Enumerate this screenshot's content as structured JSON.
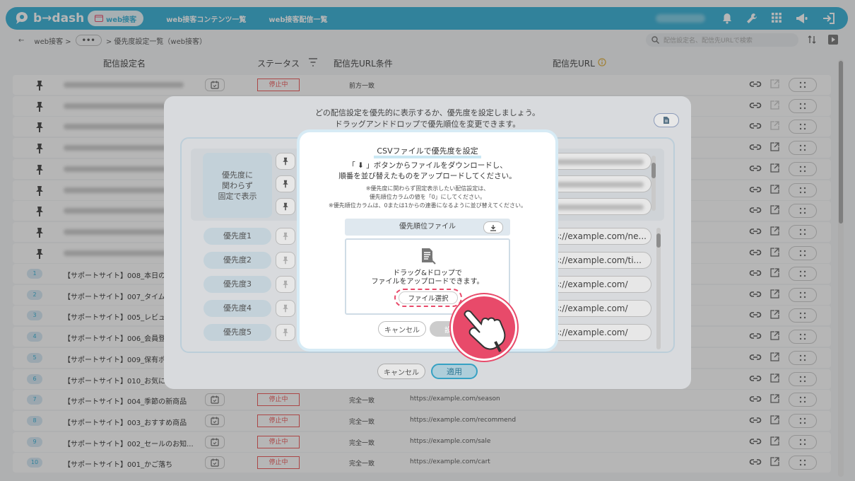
{
  "app": {
    "logo_text": "b→dash",
    "nav_active": "web接客",
    "nav_links": [
      "web接客コンテンツ一覧",
      "web接客配信一覧"
    ]
  },
  "breadcrumb": {
    "back": "←",
    "root": "web接客 >",
    "dots": "•••",
    "current": "> 優先度設定一覧（web接客）"
  },
  "search": {
    "placeholder": "配信設定名、配信先URLで検索"
  },
  "table": {
    "headers": {
      "name": "配信設定名",
      "status": "ステータス",
      "condition": "配信先URL条件",
      "url": "配信先URL"
    },
    "pinned_first": {
      "status": "停止中",
      "condition": "前方一致"
    },
    "rows": [
      {
        "num": "1",
        "name": "【サポートサイト】008_本日の新"
      },
      {
        "num": "2",
        "name": "【サポートサイト】007_タイムセ"
      },
      {
        "num": "3",
        "name": "【サポートサイト】005_レビュー"
      },
      {
        "num": "4",
        "name": "【サポートサイト】006_会員登録"
      },
      {
        "num": "5",
        "name": "【サポートサイト】009_保有ポー"
      },
      {
        "num": "6",
        "name": "【サポートサイト】010_お気に入"
      },
      {
        "num": "7",
        "name": "【サポートサイト】004_季節の新商品",
        "status": "停止中",
        "condition": "完全一致",
        "url": "https://example.com/season"
      },
      {
        "num": "8",
        "name": "【サポートサイト】003_おすすめ商品",
        "status": "停止中",
        "condition": "完全一致",
        "url": "https://example.com/recommend"
      },
      {
        "num": "9",
        "name": "【サポートサイト】002_セールのお知...",
        "status": "停止中",
        "condition": "完全一致",
        "url": "https://example.com/sale"
      },
      {
        "num": "10",
        "name": "【サポートサイト】001_かご落ち",
        "status": "停止中",
        "condition": "完全一致",
        "url": "https://example.com/cart"
      }
    ]
  },
  "priority_modal": {
    "instruction_1": "どの配信設定を優先的に表示するか、優先度を設定しましょう。",
    "instruction_2": "ドラッグアンドドロップで優先順位を変更できます。",
    "fixed_label_1": "優先度に",
    "fixed_label_2": "関わらず",
    "fixed_label_3": "固定で表示",
    "priorities": [
      {
        "label": "優先度1",
        "url": "s://example.com/ne..."
      },
      {
        "label": "優先度2",
        "url": "s://example.com/ti..."
      },
      {
        "label": "優先度3",
        "url": "s://example.com/"
      },
      {
        "label": "優先度4",
        "url": "s://example.com/"
      },
      {
        "label": "優先度5",
        "url": "s://example.com/"
      }
    ],
    "cancel": "キャンセル",
    "apply": "適用"
  },
  "csv_modal": {
    "title": "CSVファイルで優先度を設定",
    "desc_1": "「 ⬇ 」ボタンからファイルをダウンロードし、",
    "desc_2": "順番を並び替えたものをアップロードしてください。",
    "note_1": "※優先度に関わらず固定表示したい配信設定は、",
    "note_2": "優先順位カラムの値を「0」にしてください。",
    "note_3": "※優先順位カラムは、0または1からの連番になるように並び替えてください。",
    "file_header": "優先順位ファイル",
    "drop_text_1": "ドラッグ&ドロップで",
    "drop_text_2": "ファイルをアップロードできます。",
    "file_select": "ファイル選択",
    "cancel": "キャンセル",
    "ok": "設定"
  },
  "colors": {
    "brand": "#36b0d6",
    "highlight": "#e84a6a",
    "status_stopped": "#e55555"
  }
}
